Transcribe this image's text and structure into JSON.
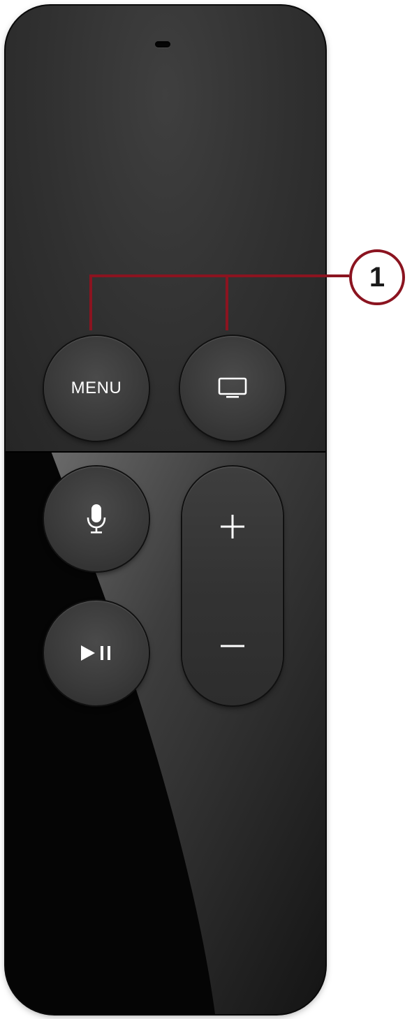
{
  "remote": {
    "buttons": {
      "menu_label": "MENU",
      "tv_icon": "tv-icon",
      "siri_icon": "microphone-icon",
      "play_pause_icon": "play-pause-icon",
      "volume_up_icon": "plus-icon",
      "volume_down_icon": "minus-icon"
    }
  },
  "callout": {
    "number": "1",
    "color": "#8b1420"
  }
}
